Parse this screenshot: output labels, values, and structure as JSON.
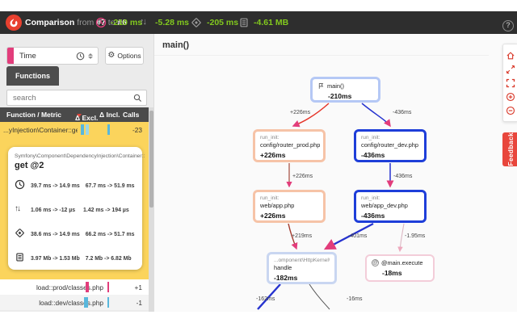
{
  "topbar": {
    "title": {
      "app": "Comparison",
      "from_word": "from",
      "ref_a": "#7",
      "to_word": "to",
      "ref_b": "#6"
    },
    "metrics": [
      {
        "icon": "wall-time-icon",
        "value": "-210 ms"
      },
      {
        "icon": "io-time-icon",
        "value": "-5.28 ms"
      },
      {
        "icon": "cpu-time-icon",
        "value": "-205 ms"
      },
      {
        "icon": "memory-icon",
        "value": "-4.61 MB"
      }
    ],
    "help": "?"
  },
  "sidebar": {
    "dimension_select": {
      "value": "Time"
    },
    "options_label": "Options",
    "tab_label": "Functions",
    "search_placeholder": "search",
    "table": {
      "headers": {
        "function": "Function / Metric",
        "excl": "Δ Excl.",
        "incl": "Δ Incl.",
        "calls": "Calls"
      },
      "selected_row": {
        "name": "...yInjection\\Container::get",
        "badge": "@2",
        "calls": "-23"
      },
      "rows": [
        {
          "name": "load::prod/classes.php",
          "calls": "+1"
        },
        {
          "name": "load::dev/classes.php",
          "calls": "-1"
        }
      ]
    },
    "tooltip": {
      "class_line": "Symfony\\Component\\DependencyInjection\\Container::",
      "method_line": "get @2",
      "metrics": [
        {
          "icon": "wall-time-icon",
          "excl": "39.7 ms -> 14.9 ms",
          "incl": "67.7 ms -> 51.9 ms"
        },
        {
          "icon": "io-time-icon",
          "excl": "1.06 ms -> -12 µs",
          "incl": "1.42 ms -> 194 µs"
        },
        {
          "icon": "cpu-time-icon",
          "excl": "38.6 ms -> 14.9 ms",
          "incl": "66.2 ms -> 51.7 ms"
        },
        {
          "icon": "memory-icon",
          "excl": "3.97 Mb -> 1.53 Mb",
          "incl": "7.2 Mb -> 6.82 Mb"
        }
      ]
    }
  },
  "graph": {
    "header": "main()",
    "nodes": [
      {
        "id": "main",
        "icon": "flag-icon",
        "title": "main()",
        "delta": "-210ms"
      },
      {
        "id": "router-prod",
        "line1": "run_init:",
        "line2": "config/router_prod.php",
        "delta": "+226ms"
      },
      {
        "id": "router-dev",
        "line1": "run_init:",
        "line2": "config/router_dev.php",
        "delta": "-436ms"
      },
      {
        "id": "web-app",
        "line1": "run_init:",
        "line2": "web/app.php",
        "delta": "+226ms"
      },
      {
        "id": "web-app-dev",
        "line1": "run_init:",
        "line2": "web/app_dev.php",
        "delta": "-436ms"
      },
      {
        "id": "kernel-handle",
        "line1": "...omponent\\HttpKernel\\Kernel::",
        "line2": "handle",
        "delta": "-182ms"
      },
      {
        "id": "main-execute",
        "icon": "at-icon",
        "title": "@main.execute",
        "delta": "-18ms"
      }
    ],
    "edges": [
      {
        "label": "+226ms"
      },
      {
        "label": "-436ms"
      },
      {
        "label": "+226ms"
      },
      {
        "label": "-436ms"
      },
      {
        "label": "+219ms"
      },
      {
        "label": "-401ms"
      },
      {
        "label": "-1.95ms"
      },
      {
        "label": "-162ms"
      },
      {
        "label": "-16ms"
      }
    ]
  },
  "right_rail": {
    "feedback_label": "Feedback"
  },
  "colors": {
    "accent_pink": "#e23d7b",
    "positive_green": "#82c91e",
    "brand_red": "#e8402f",
    "edge_red": "#e53529",
    "edge_blue": "#2633cf",
    "node_blue_border": "#1e3ed9",
    "node_salmon_border": "#f6c3a7",
    "highlight_yellow": "#fbd45c",
    "rail_red": "#d93a2b"
  }
}
